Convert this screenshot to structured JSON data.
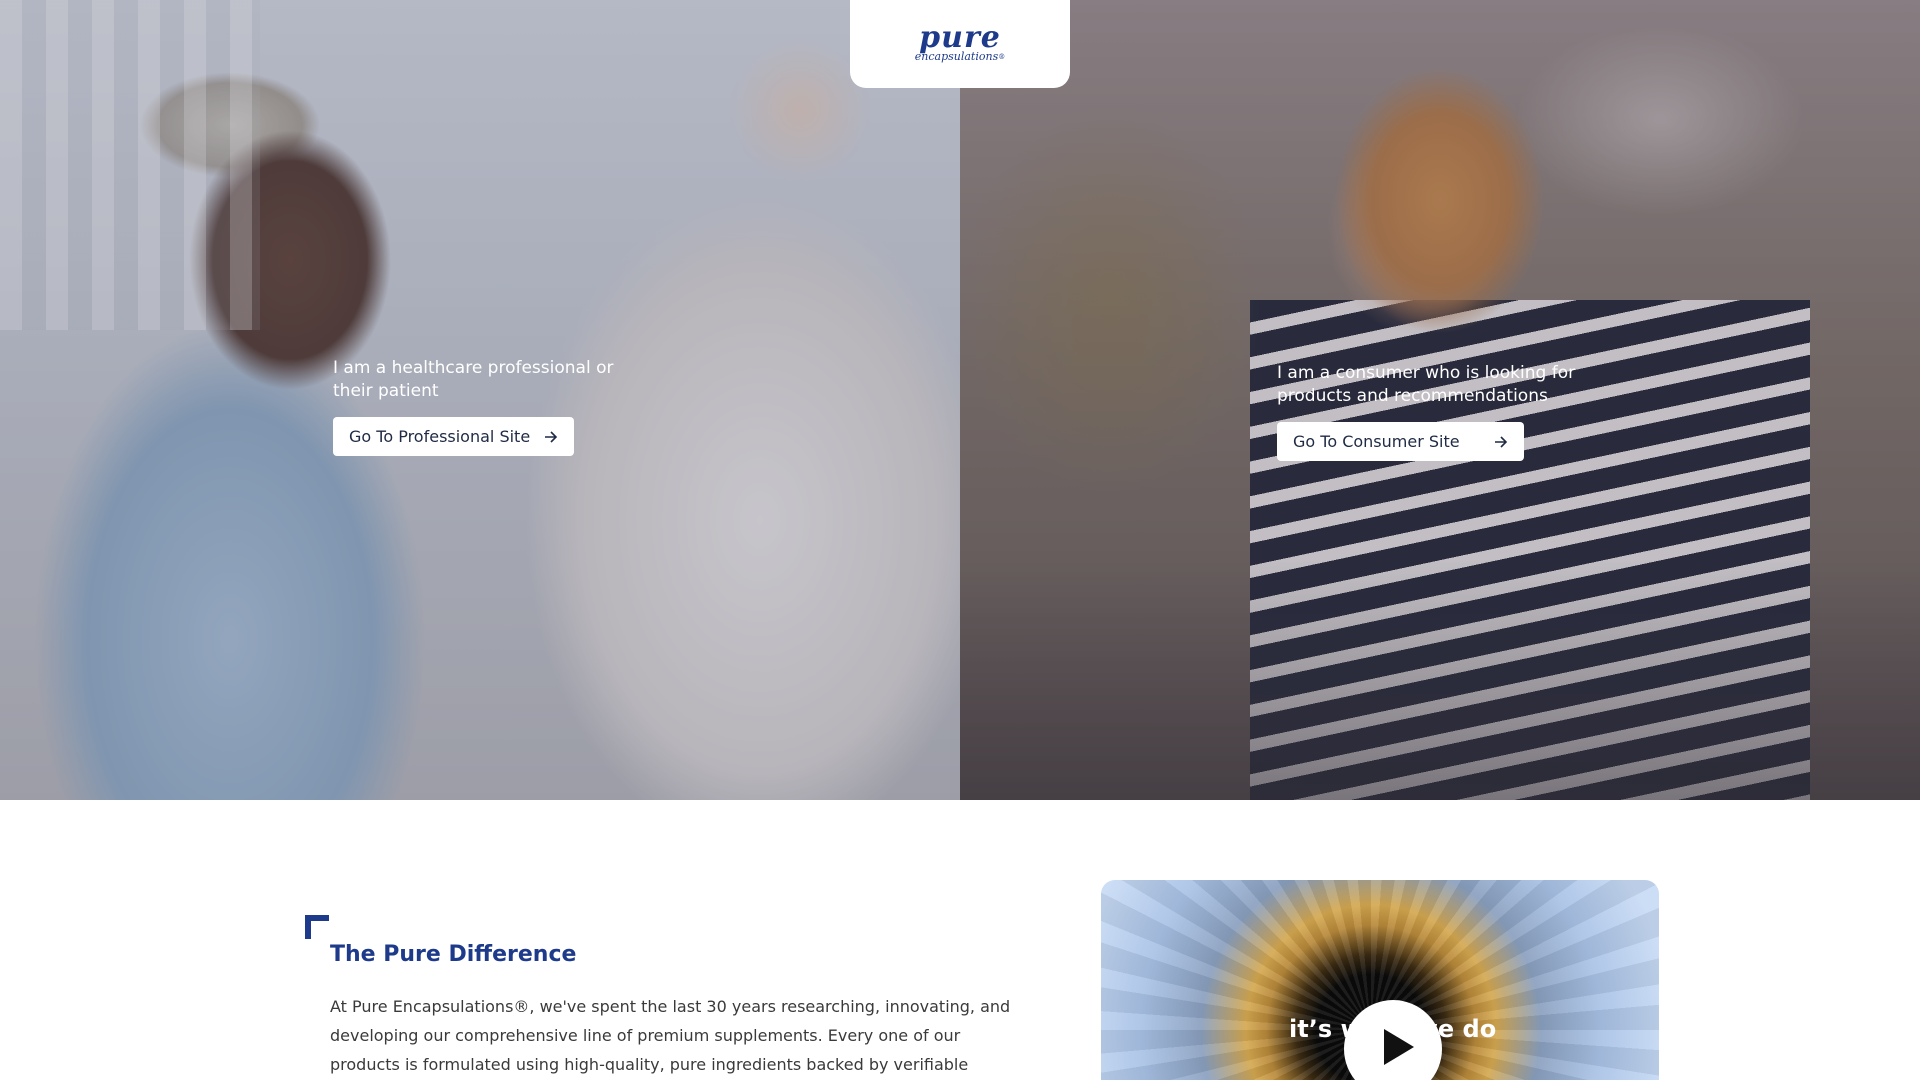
{
  "brand": {
    "logo_word": "pure",
    "logo_sub": "encapsulations",
    "logo_mark": "®",
    "color": "#1e3a8a"
  },
  "hero": {
    "professional": {
      "text": "I am a healthcare professional or their patient",
      "button_label": "Go To Professional Site",
      "button_icon": "arrow-right-icon"
    },
    "consumer": {
      "text": "I am a consumer who is looking for products and recommendations",
      "button_label": "Go To Consumer Site",
      "button_icon": "arrow-right-icon"
    }
  },
  "intro": {
    "title": "The Pure Difference",
    "body": "At Pure Encapsulations®, we've spent the last 30 years researching, innovating, and developing our comprehensive line of premium supplements. Every one of our products is formulated using high-quality, pure ingredients backed by verifiable science and FREE"
  },
  "video": {
    "caption": "it’s what we do",
    "play_icon": "play-icon"
  }
}
